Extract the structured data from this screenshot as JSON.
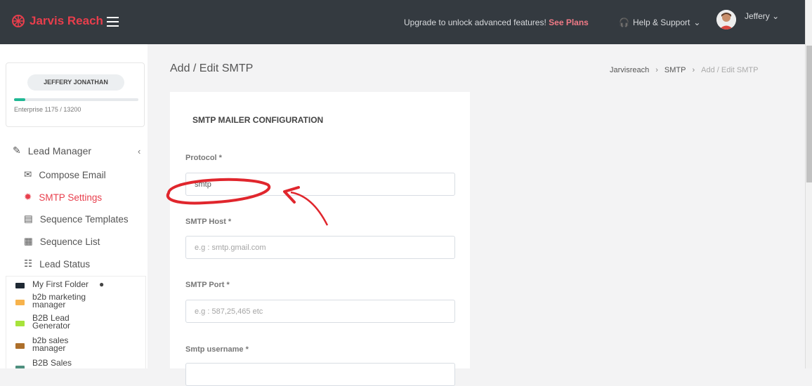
{
  "header": {
    "brand": "Jarvis Reach",
    "upgrade_text": "Upgrade to unlock advanced features!",
    "upgrade_link": "See Plans",
    "help": "Help & Support",
    "user": "Jeffery"
  },
  "sidebar": {
    "user_name": "JEFFERY JONATHAN",
    "plan": "Enterprise 1175 / 13200",
    "usage_fraction": 0.089,
    "menu_title": "Lead Manager",
    "items": [
      {
        "label": "Compose Email",
        "icon": "envelope-icon"
      },
      {
        "label": "SMTP Settings",
        "icon": "gear-icon",
        "active": true
      },
      {
        "label": "Sequence Templates",
        "icon": "templates-icon"
      },
      {
        "label": "Sequence List",
        "icon": "list-icon"
      },
      {
        "label": "Lead Status",
        "icon": "checklist-icon"
      }
    ],
    "folders": [
      {
        "name": "My First Folder",
        "color": "#1f2933"
      },
      {
        "name": "b2b marketing manager",
        "color": "#f7b34c"
      },
      {
        "name": "B2B Lead Generator",
        "color": "#a7e33b"
      },
      {
        "name": "b2b sales manager",
        "color": "#ad6f2b"
      },
      {
        "name": "B2B Sales",
        "color": "#4e8f7e"
      }
    ]
  },
  "main": {
    "title": "Add / Edit SMTP",
    "breadcrumb": [
      "Jarvisreach",
      "SMTP",
      "Add / Edit SMTP"
    ],
    "panel_title": "SMTP MAILER CONFIGURATION",
    "fields": {
      "protocol": {
        "label": "Protocol *",
        "value": "smtp"
      },
      "host": {
        "label": "SMTP Host *",
        "placeholder": "e.g : smtp.gmail.com"
      },
      "port": {
        "label": "SMTP Port *",
        "placeholder": "e.g : 587,25,465 etc"
      },
      "username": {
        "label": "Smtp username *"
      }
    }
  },
  "colors": {
    "accent": "#e83e4c",
    "topbar": "#343a40",
    "annotation": "#e0262d"
  }
}
